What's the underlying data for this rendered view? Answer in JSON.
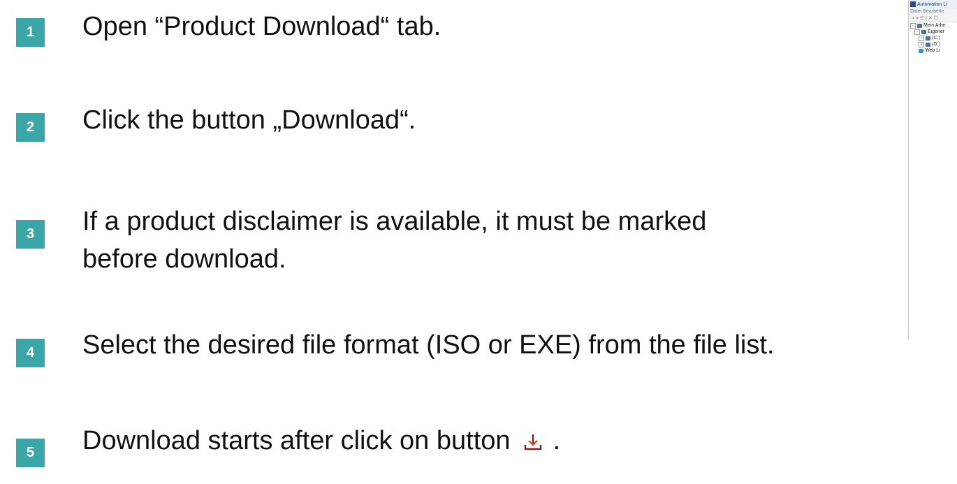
{
  "steps": [
    {
      "number": "1",
      "text": "Open “Product Download“ tab."
    },
    {
      "number": "2",
      "text": "Click the button „Download“."
    },
    {
      "number": "3",
      "text_line1": "If a product disclaimer is available, it must be marked",
      "text_line2": "before download."
    },
    {
      "number": "4",
      "text": "Select the desired file format (ISO or EXE) from the file list."
    },
    {
      "number": "5",
      "text_before": "Download starts after click on button",
      "text_after": "."
    }
  ],
  "colors": {
    "badge": "#3aa6a8",
    "download_icon": "#8b1a1a"
  },
  "thumbnail": {
    "title": "Automation Li",
    "menu": "Datei  Bearbeite",
    "toolbar": "⇢ ≡ ☰ | ✕ ☐",
    "tree": [
      {
        "label": "Mein Arbe",
        "expander": "−"
      },
      {
        "label": "Eigener",
        "expander": "−"
      },
      {
        "label": "(C:)",
        "expander": "+"
      },
      {
        "label": "(D:)",
        "expander": "+"
      },
      {
        "label": "Web Li"
      }
    ]
  }
}
